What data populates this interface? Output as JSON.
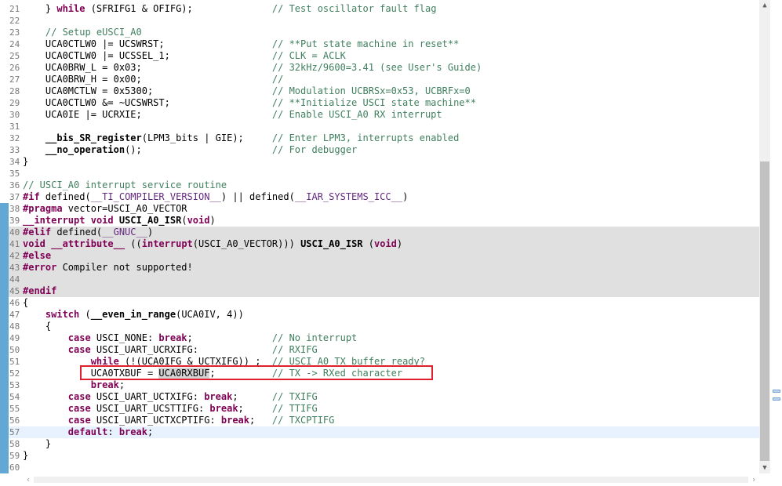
{
  "editor": {
    "lines": [
      {
        "n": "21",
        "t": "    } while (SFRIFG1 & OFIFG);              // Test oscillator fault flag"
      },
      {
        "n": "22",
        "t": ""
      },
      {
        "n": "23",
        "t": "    // Setup eUSCI_A0"
      },
      {
        "n": "24",
        "t": "    UCA0CTLW0 |= UCSWRST;                   // **Put state machine in reset**"
      },
      {
        "n": "25",
        "t": "    UCA0CTLW0 |= UCSSEL_1;                  // CLK = ACLK"
      },
      {
        "n": "26",
        "t": "    UCA0BRW_L = 0x03;                       // 32kHz/9600=3.41 (see User's Guide)"
      },
      {
        "n": "27",
        "t": "    UCA0BRW_H = 0x00;                       //"
      },
      {
        "n": "28",
        "t": "    UCA0MCTLW = 0x5300;                     // Modulation UCBRSx=0x53, UCBRFx=0"
      },
      {
        "n": "29",
        "t": "    UCA0CTLW0 &= ~UCSWRST;                  // **Initialize USCI state machine**"
      },
      {
        "n": "30",
        "t": "    UCA0IE |= UCRXIE;                       // Enable USCI_A0 RX interrupt"
      },
      {
        "n": "31",
        "t": ""
      },
      {
        "n": "32",
        "t": "    __bis_SR_register(LPM3_bits | GIE);     // Enter LPM3, interrupts enabled"
      },
      {
        "n": "33",
        "t": "    __no_operation();                       // For debugger"
      },
      {
        "n": "34",
        "t": "}"
      },
      {
        "n": "35",
        "t": ""
      },
      {
        "n": "36",
        "t": "// USCI_A0 interrupt service routine"
      },
      {
        "n": "37",
        "t": "#if defined(__TI_COMPILER_VERSION__) || defined(__IAR_SYSTEMS_ICC__)"
      },
      {
        "n": "38",
        "t": "#pragma vector=USCI_A0_VECTOR"
      },
      {
        "n": "39",
        "t": "__interrupt void USCI_A0_ISR(void)"
      },
      {
        "n": "40",
        "t": "#elif defined(__GNUC__)"
      },
      {
        "n": "41",
        "t": "void __attribute__ ((interrupt(USCI_A0_VECTOR))) USCI_A0_ISR (void)"
      },
      {
        "n": "42",
        "t": "#else"
      },
      {
        "n": "43",
        "t": "#error Compiler not supported!"
      },
      {
        "n": "44",
        "t": ""
      },
      {
        "n": "45",
        "t": "#endif"
      },
      {
        "n": "46",
        "t": "{"
      },
      {
        "n": "47",
        "t": "    switch (__even_in_range(UCA0IV, 4))"
      },
      {
        "n": "48",
        "t": "    {"
      },
      {
        "n": "49",
        "t": "        case USCI_NONE: break;              // No interrupt"
      },
      {
        "n": "50",
        "t": "        case USCI_UART_UCRXIFG:             // RXIFG"
      },
      {
        "n": "51",
        "t": "            while (!(UCA0IFG & UCTXIFG)) ;  // USCI_A0 TX buffer ready?"
      },
      {
        "n": "52",
        "t": "            UCA0TXBUF = UCA0RXBUF;          // TX -> RXed character"
      },
      {
        "n": "53",
        "t": "            break;"
      },
      {
        "n": "54",
        "t": "        case USCI_UART_UCTXIFG: break;      // TXIFG"
      },
      {
        "n": "55",
        "t": "        case USCI_UART_UCSTTIFG: break;     // TTIFG"
      },
      {
        "n": "56",
        "t": "        case USCI_UART_UCTXCPTIFG: break;   // TXCPTIFG"
      },
      {
        "n": "57",
        "t": "        default: break;"
      },
      {
        "n": "58",
        "t": "    }"
      },
      {
        "n": "59",
        "t": "}"
      },
      {
        "n": "60",
        "t": ""
      }
    ],
    "inactive_lines": [
      "40",
      "41",
      "42",
      "43",
      "44",
      "45"
    ],
    "current_line": "57",
    "highlighted_line": "52",
    "occurrence": "UCA0RXBUF"
  },
  "colors": {
    "keyword": "#7f0055",
    "comment": "#3f7f5f",
    "inactive_bg": "#e0e0e0",
    "current_line_bg": "#e8f2fe",
    "highlight_box": "#e0202c"
  }
}
